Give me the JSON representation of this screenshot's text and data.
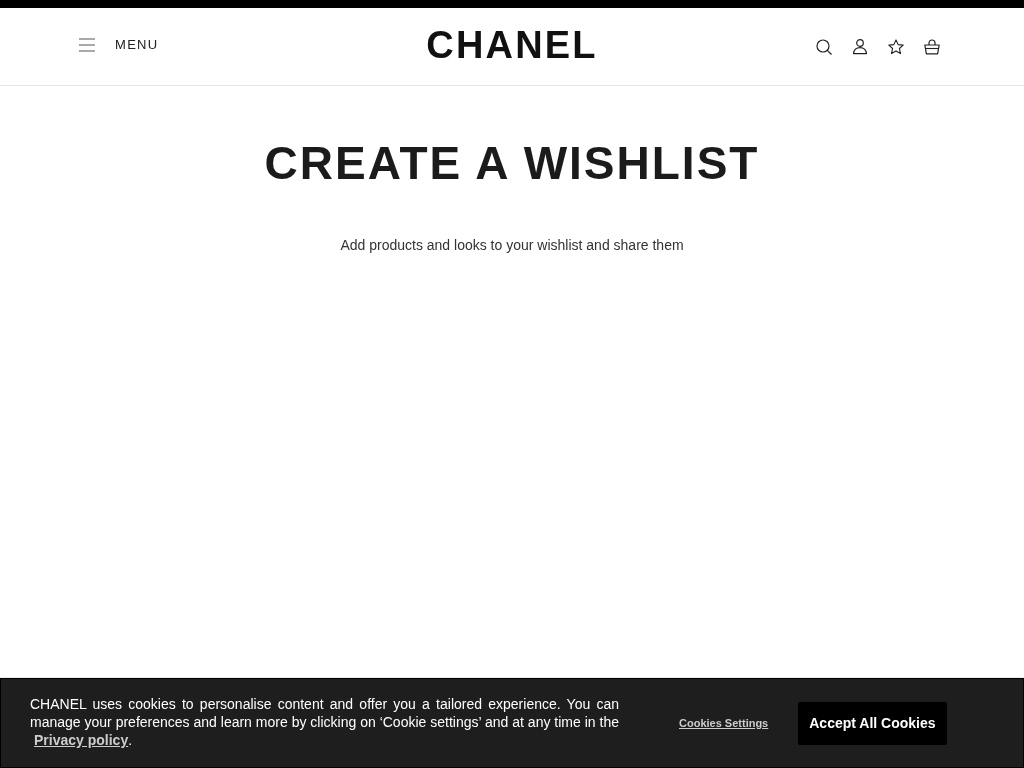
{
  "header": {
    "menu_label": "MENU",
    "logo": "CHANEL"
  },
  "page": {
    "title": "CREATE A WISHLIST",
    "subtitle": "Add products and looks to your wishlist and share them"
  },
  "cookie_banner": {
    "text": "CHANEL uses cookies to personalise content and offer you a tailored experience. You can manage your preferences and learn more by clicking on ‘Cookie settings’ and at any time in the",
    "privacy_link": "Privacy policy",
    "text_end": ".",
    "settings_link": "Cookies Settings",
    "accept_button": "Accept All Cookies"
  }
}
